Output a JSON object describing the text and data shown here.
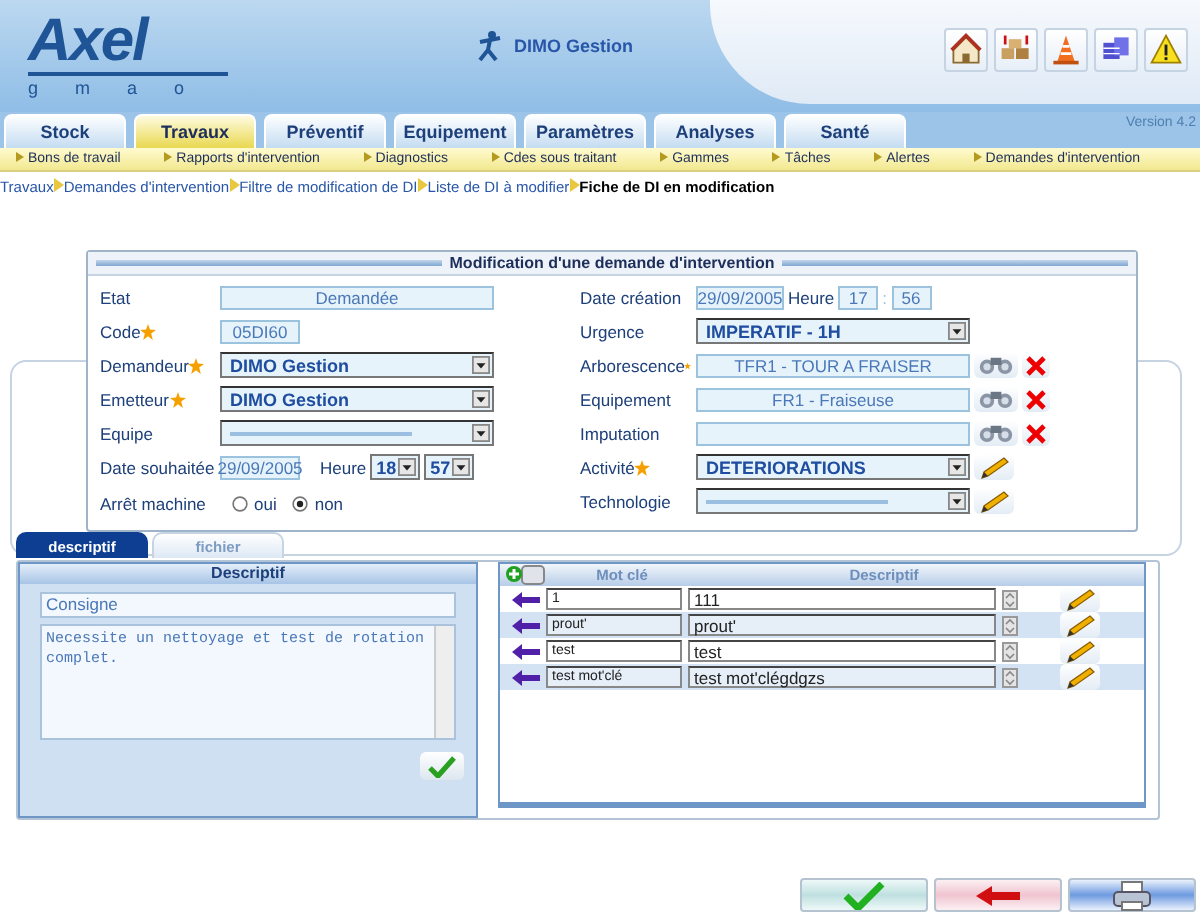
{
  "header": {
    "logo": "Axel",
    "logo_sub": "g m a o",
    "user": "DIMO Gestion",
    "version": "Version 4.2"
  },
  "tabs": [
    {
      "label": "Stock",
      "selected": false
    },
    {
      "label": "Travaux",
      "selected": true
    },
    {
      "label": "Préventif",
      "selected": false
    },
    {
      "label": "Equipement",
      "selected": false
    },
    {
      "label": "Paramètres",
      "selected": false
    },
    {
      "label": "Analyses",
      "selected": false
    },
    {
      "label": "Santé",
      "selected": false
    }
  ],
  "submenu": [
    "Bons de travail",
    "Rapports d'intervention",
    "Diagnostics",
    "Cdes sous traitant",
    "Gammes",
    "Tâches",
    "Alertes",
    "Demandes d'intervention"
  ],
  "breadcrumb": [
    {
      "label": "Travaux",
      "current": false
    },
    {
      "label": "Demandes d'intervention",
      "current": false
    },
    {
      "label": "Filtre de modification de DI",
      "current": false
    },
    {
      "label": "Liste de DI à modifier",
      "current": false
    },
    {
      "label": "Fiche de DI en modification",
      "current": true
    }
  ],
  "form": {
    "title": "Modification d'une demande d'intervention",
    "left": [
      {
        "kind": "status",
        "label": "Etat",
        "value": "Demandée",
        "required": false
      },
      {
        "kind": "code",
        "label": "Code",
        "value": "05DI60",
        "required": true
      },
      {
        "kind": "select",
        "label": "Demandeur",
        "value": "DIMO Gestion",
        "required": true
      },
      {
        "kind": "select",
        "label": "Emetteur",
        "value": "DIMO Gestion",
        "required": true
      },
      {
        "kind": "select",
        "label": "Equipe",
        "required": false
      },
      {
        "kind": "datetime_select",
        "label": "Date souhaitée",
        "date": "29/09/2005",
        "time_label": "Heure",
        "hour": "18",
        "minute": "57",
        "required": false
      },
      {
        "kind": "radio",
        "label": "Arrêt machine",
        "required": false,
        "options": [
          {
            "label": "oui",
            "selected": false
          },
          {
            "label": "non",
            "selected": true
          }
        ]
      }
    ],
    "right": [
      {
        "kind": "datetime_box",
        "label": "Date création",
        "date": "29/09/2005",
        "time_label": "Heure",
        "hour": "17",
        "separator": ":",
        "minute": "56",
        "required": false
      },
      {
        "kind": "select",
        "label": "Urgence",
        "value": "IMPERATIF - 1H",
        "required": false
      },
      {
        "kind": "lookup",
        "label": "Arborescence",
        "value": "TFR1 - TOUR A FRAISER",
        "required": true
      },
      {
        "kind": "lookup",
        "label": "Equipement",
        "value": "FR1 - Fraiseuse",
        "required": false
      },
      {
        "kind": "lookup",
        "label": "Imputation",
        "required": false
      },
      {
        "kind": "select_edit",
        "label": "Activité",
        "value": "DETERIORATIONS",
        "required": true
      },
      {
        "kind": "select_edit",
        "label": "Technologie",
        "required": false
      }
    ]
  },
  "lower_tabs": [
    {
      "label": "descriptif",
      "selected": true
    },
    {
      "label": "fichier",
      "selected": false
    }
  ],
  "descriptif": {
    "title": "Descriptif",
    "consigne": "Consigne",
    "text": "Necessite un nettoyage et test de rotation complet."
  },
  "keywords": {
    "columns": [
      "Mot clé",
      "Descriptif"
    ],
    "rows": [
      {
        "keyword": "1",
        "description": "111"
      },
      {
        "keyword": "prout'",
        "description": "prout'"
      },
      {
        "keyword": "test",
        "description": "test"
      },
      {
        "keyword": "test mot'clé",
        "description": "test mot'clégdgzs"
      }
    ]
  }
}
